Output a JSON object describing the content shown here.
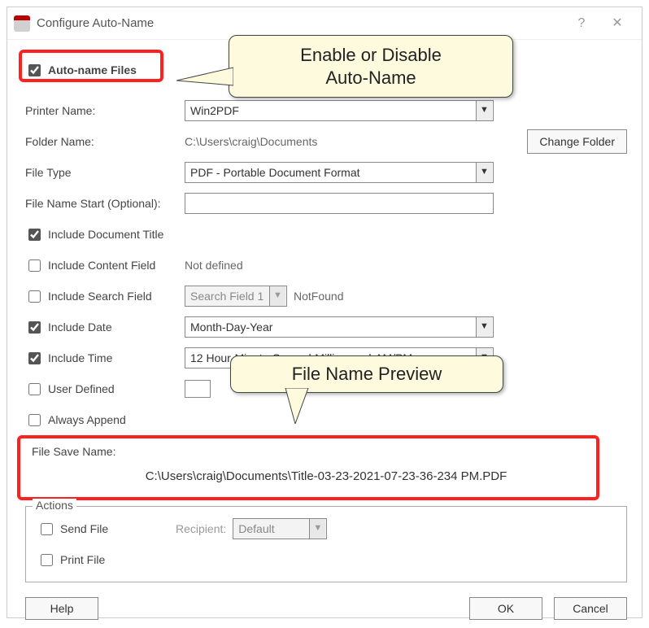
{
  "window": {
    "title": "Configure Auto-Name"
  },
  "callouts": {
    "top": "Enable or Disable\nAuto-Name",
    "mid": "File Name Preview"
  },
  "form": {
    "autoNameFiles": {
      "label": "Auto-name Files",
      "checked": true
    },
    "printerName": {
      "label": "Printer Name:",
      "value": "Win2PDF"
    },
    "folderName": {
      "label": "Folder Name:",
      "value": "C:\\Users\\craig\\Documents"
    },
    "changeFolder": "Change Folder",
    "fileType": {
      "label": "File Type",
      "value": "PDF - Portable Document Format"
    },
    "fileNameStart": {
      "label": "File Name Start (Optional):",
      "value": ""
    },
    "includeDocTitle": {
      "label": "Include Document Title",
      "checked": true
    },
    "includeContentField": {
      "label": "Include Content Field",
      "checked": false,
      "note": "Not defined"
    },
    "includeSearchField": {
      "label": "Include Search Field",
      "checked": false,
      "dropdown": "Search Field 1",
      "note": "NotFound"
    },
    "includeDate": {
      "label": "Include Date",
      "checked": true,
      "value": "Month-Day-Year"
    },
    "includeTime": {
      "label": "Include Time",
      "checked": true,
      "value": "12 Hour-Minute-Second-Millisecond-AM/PM"
    },
    "userDefined": {
      "label": "User Defined",
      "checked": false
    },
    "alwaysAppend": {
      "label": "Always Append",
      "checked": false
    },
    "fileSaveName": {
      "label": "File Save Name:",
      "value": "C:\\Users\\craig\\Documents\\Title-03-23-2021-07-23-36-234 PM.PDF"
    }
  },
  "actions": {
    "legend": "Actions",
    "sendFile": {
      "label": "Send File",
      "checked": false
    },
    "recipient": {
      "label": "Recipient:",
      "value": "Default"
    },
    "printFile": {
      "label": "Print File",
      "checked": false
    }
  },
  "footer": {
    "help": "Help",
    "ok": "OK",
    "cancel": "Cancel"
  }
}
